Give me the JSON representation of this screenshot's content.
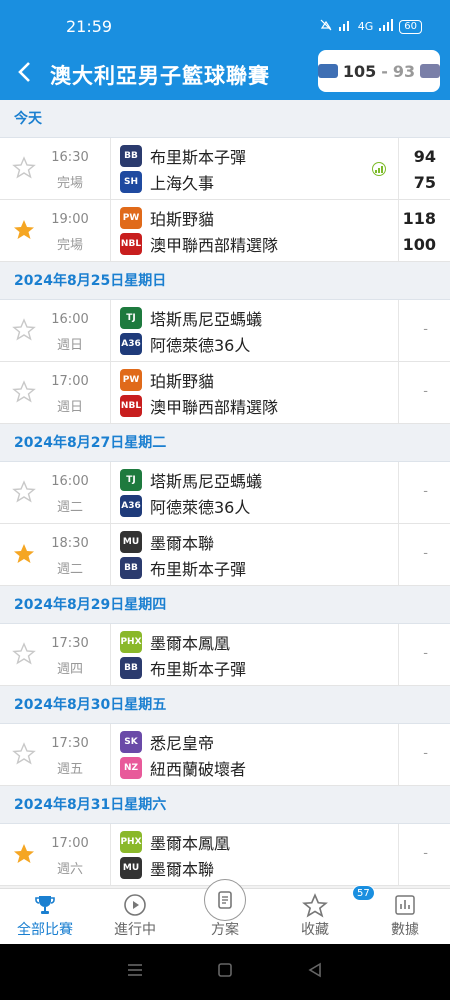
{
  "status_bar": {
    "time": "21:59",
    "signal": "4G",
    "battery": "60"
  },
  "header": {
    "title": "澳大利亞男子籃球聯賽",
    "score_home": "105",
    "score_sep": "-",
    "score_away": "93"
  },
  "sections": [
    {
      "label": "今天",
      "matches": [
        {
          "time": "16:30",
          "status": "完場",
          "starred": false,
          "home": {
            "name": "布里斯本子彈",
            "logo_color": "#2b3b6e",
            "logo_text": "BB"
          },
          "away": {
            "name": "上海久事",
            "logo_color": "#1f4aa0",
            "logo_text": "SH"
          },
          "home_score": "94",
          "away_score": "75",
          "stats": true
        },
        {
          "time": "19:00",
          "status": "完場",
          "starred": true,
          "home": {
            "name": "珀斯野貓",
            "logo_color": "#e06a1a",
            "logo_text": "PW"
          },
          "away": {
            "name": "澳甲聯西部精選隊",
            "logo_color": "#c81e1e",
            "logo_text": "NBL"
          },
          "home_score": "118",
          "away_score": "100",
          "stats": false
        }
      ]
    },
    {
      "label": "2024年8月25日星期日",
      "matches": [
        {
          "time": "16:00",
          "status": "週日",
          "starred": false,
          "home": {
            "name": "塔斯馬尼亞螞蟻",
            "logo_color": "#1e7a3e",
            "logo_text": "TJ"
          },
          "away": {
            "name": "阿德萊德36人",
            "logo_color": "#1f3b7a",
            "logo_text": "A36"
          },
          "home_score": "",
          "away_score": "",
          "dash": "-"
        },
        {
          "time": "17:00",
          "status": "週日",
          "starred": false,
          "home": {
            "name": "珀斯野貓",
            "logo_color": "#e06a1a",
            "logo_text": "PW"
          },
          "away": {
            "name": "澳甲聯西部精選隊",
            "logo_color": "#c81e1e",
            "logo_text": "NBL"
          },
          "home_score": "",
          "away_score": "",
          "dash": "-"
        }
      ]
    },
    {
      "label": "2024年8月27日星期二",
      "matches": [
        {
          "time": "16:00",
          "status": "週二",
          "starred": false,
          "home": {
            "name": "塔斯馬尼亞螞蟻",
            "logo_color": "#1e7a3e",
            "logo_text": "TJ"
          },
          "away": {
            "name": "阿德萊德36人",
            "logo_color": "#1f3b7a",
            "logo_text": "A36"
          },
          "home_score": "",
          "away_score": "",
          "dash": "-"
        },
        {
          "time": "18:30",
          "status": "週二",
          "starred": true,
          "home": {
            "name": "墨爾本聯",
            "logo_color": "#333333",
            "logo_text": "MU"
          },
          "away": {
            "name": "布里斯本子彈",
            "logo_color": "#2b3b6e",
            "logo_text": "BB"
          },
          "home_score": "",
          "away_score": "",
          "dash": "-"
        }
      ]
    },
    {
      "label": "2024年8月29日星期四",
      "matches": [
        {
          "time": "17:30",
          "status": "週四",
          "starred": false,
          "home": {
            "name": "墨爾本鳳凰",
            "logo_color": "#8ab82a",
            "logo_text": "PHX"
          },
          "away": {
            "name": "布里斯本子彈",
            "logo_color": "#2b3b6e",
            "logo_text": "BB"
          },
          "home_score": "",
          "away_score": "",
          "dash": "-"
        }
      ]
    },
    {
      "label": "2024年8月30日星期五",
      "matches": [
        {
          "time": "17:30",
          "status": "週五",
          "starred": false,
          "home": {
            "name": "悉尼皇帝",
            "logo_color": "#6a4aa8",
            "logo_text": "SK"
          },
          "away": {
            "name": "紐西蘭破壞者",
            "logo_color": "#e85a9a",
            "logo_text": "NZ"
          },
          "home_score": "",
          "away_score": "",
          "dash": "-"
        }
      ]
    },
    {
      "label": "2024年8月31日星期六",
      "matches": [
        {
          "time": "17:00",
          "status": "週六",
          "starred": true,
          "home": {
            "name": "墨爾本鳳凰",
            "logo_color": "#8ab82a",
            "logo_text": "PHX"
          },
          "away": {
            "name": "墨爾本聯",
            "logo_color": "#333333",
            "logo_text": "MU"
          },
          "home_score": "",
          "away_score": "",
          "dash": "-"
        }
      ]
    }
  ],
  "bottom_nav": [
    {
      "label": "全部比賽",
      "icon": "trophy-icon",
      "active": true
    },
    {
      "label": "進行中",
      "icon": "play-icon",
      "active": false
    },
    {
      "label": "方案",
      "icon": "document-icon",
      "active": false
    },
    {
      "label": "收藏",
      "icon": "star-icon",
      "active": false,
      "badge": "57"
    },
    {
      "label": "數據",
      "icon": "bar-chart-icon",
      "active": false
    }
  ],
  "colors": {
    "brand": "#1a8fe0",
    "section_text": "#1a7fd0",
    "star": "#f5a623"
  }
}
